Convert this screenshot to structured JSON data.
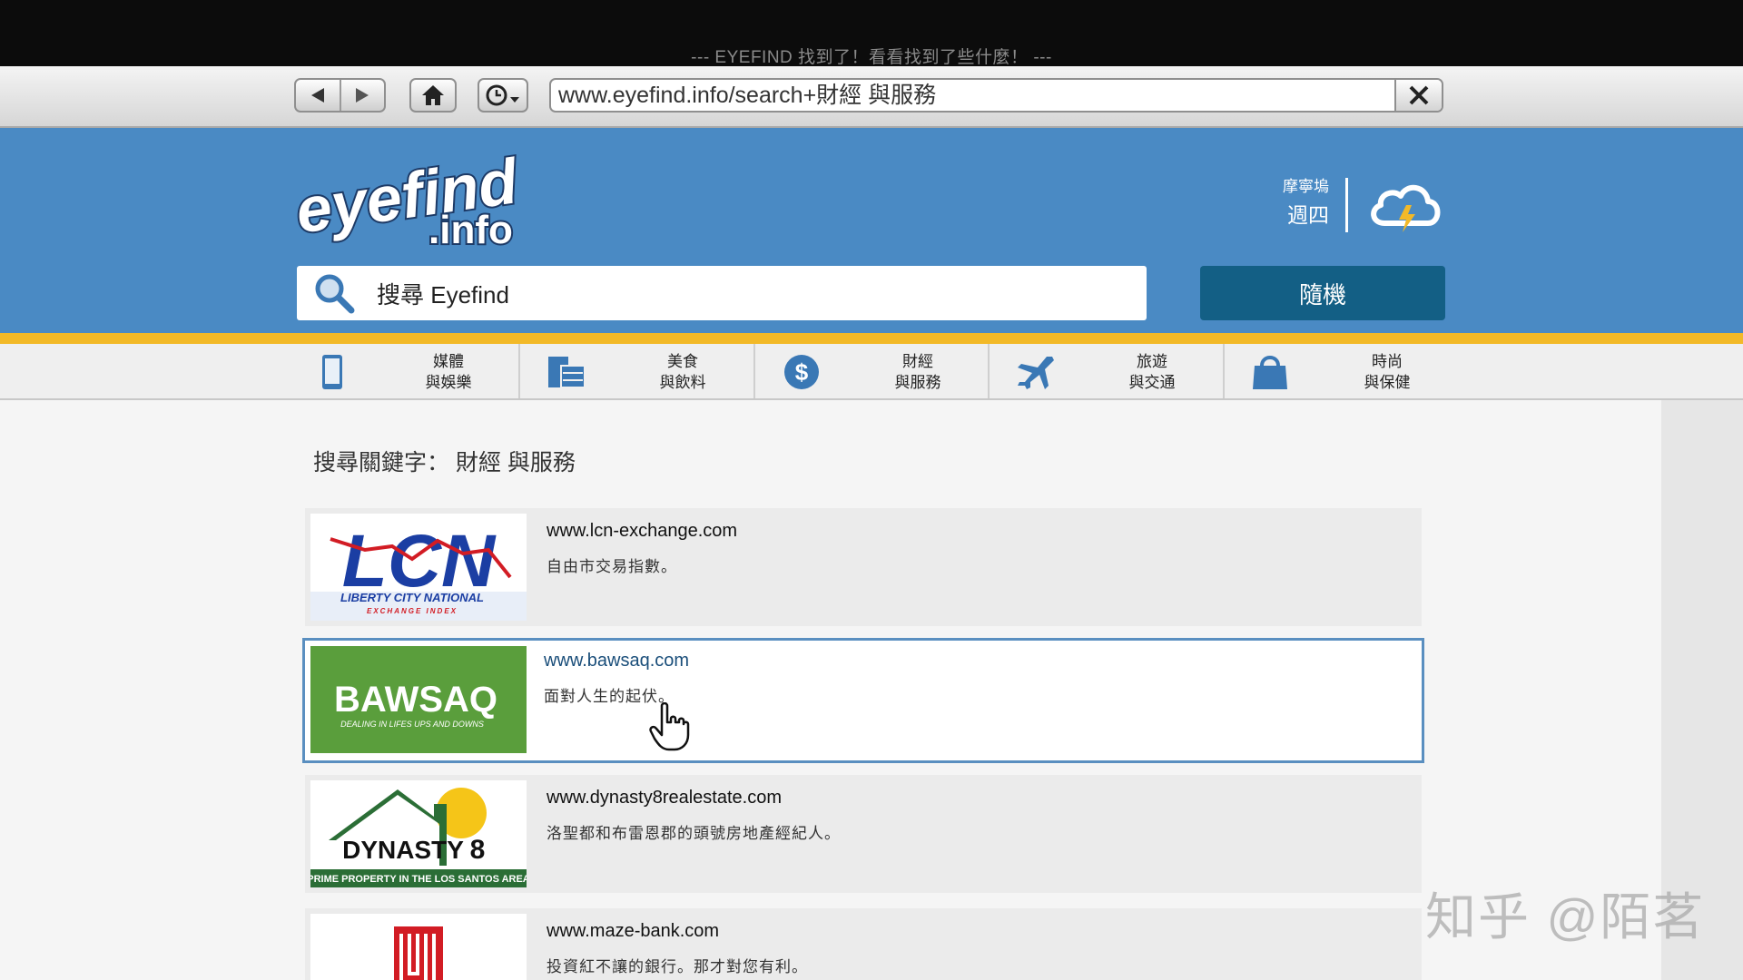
{
  "window": {
    "title": "--- EYEFIND 找到了！看看找到了些什麼！ ---"
  },
  "toolbar": {
    "url": "www.eyefind.info/search+財經 與服務",
    "icons": [
      "back-arrow-icon",
      "forward-arrow-icon",
      "home-icon",
      "history-clock-icon",
      "close-icon"
    ]
  },
  "header": {
    "logo_text_1": "eyefind",
    "logo_text_2": ".info",
    "location": "摩寧塢",
    "weekday": "週四",
    "weather_icon": "storm-cloud-icon",
    "search_placeholder": "搜尋 Eyefind",
    "random_label": "隨機"
  },
  "nav": {
    "items": [
      {
        "line1": "媒體",
        "line2": "與娛樂",
        "icon": "phone-icon"
      },
      {
        "line1": "美食",
        "line2": "與飲料",
        "icon": "food-icon"
      },
      {
        "line1": "財經",
        "line2": "與服務",
        "icon": "dollar-icon"
      },
      {
        "line1": "旅遊",
        "line2": "與交通",
        "icon": "airplane-icon"
      },
      {
        "line1": "時尚",
        "line2": "與保健",
        "icon": "shopping-bag-icon"
      }
    ]
  },
  "main": {
    "query_label": "搜尋關鍵字： 財經 與服務",
    "results": [
      {
        "url": "www.lcn-exchange.com",
        "desc": "自由市交易指數。",
        "logo_main": "LCN",
        "logo_sub1": "LIBERTY CITY NATIONAL",
        "logo_sub2": "EXCHANGE INDEX"
      },
      {
        "url": "www.bawsaq.com",
        "desc": "面對人生的起伏。",
        "logo_main": "BAWSAQ",
        "logo_sub1": "DEALING IN LIFES UPS AND DOWNS"
      },
      {
        "url": "www.dynasty8realestate.com",
        "desc": "洛聖都和布雷恩郡的頭號房地產經紀人。",
        "logo_main": "DYNASTY",
        "logo_num": "8",
        "logo_sub1": "PRIME PROPERTY IN THE LOS SANTOS AREA"
      },
      {
        "url": "www.maze-bank.com",
        "desc": "投資紅不讓的銀行。那才對您有利。"
      }
    ]
  },
  "watermark": "知乎 @陌茗",
  "colors": {
    "header_blue": "#4a8ac4",
    "accent_gold": "#f2b928",
    "random_button": "#135f85"
  }
}
